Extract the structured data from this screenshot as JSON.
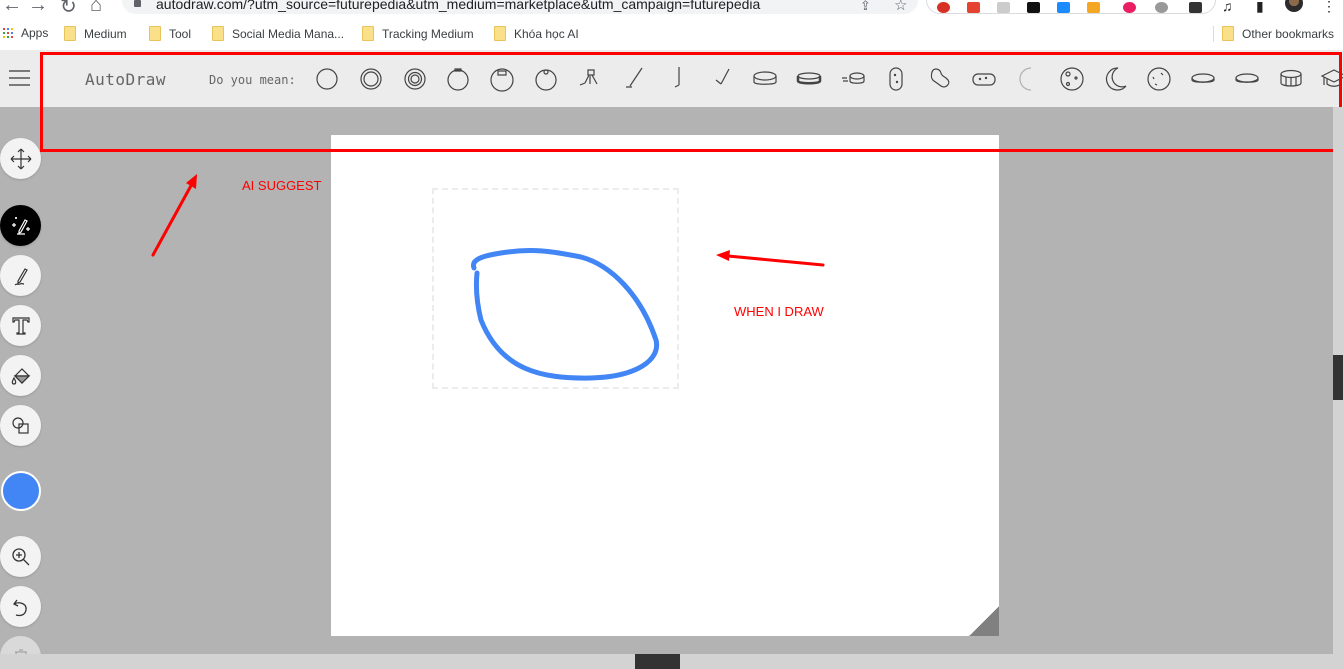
{
  "browser": {
    "url": "autodraw.com/?utm_source=futurepedia&utm_medium=marketplace&utm_campaign=futurepedia",
    "bookmarks": [
      {
        "label": "Apps",
        "icon": "apps-grid-icon"
      },
      {
        "label": "Medium",
        "icon": "folder-icon"
      },
      {
        "label": "Tool",
        "icon": "folder-icon"
      },
      {
        "label": "Social Media Mana...",
        "icon": "folder-icon"
      },
      {
        "label": "Tracking Medium",
        "icon": "folder-icon"
      },
      {
        "label": "Khóa học AI",
        "icon": "folder-icon"
      }
    ],
    "other_bookmarks": "Other bookmarks"
  },
  "header": {
    "brand": "AutoDraw",
    "suggest_label": "Do you mean:",
    "suggestions": [
      "circle",
      "double-circle",
      "triple-circle",
      "ornament",
      "blueberry",
      "blueberry-top",
      "hockey-player",
      "hockey-stick",
      "hockey-stick-vertical",
      "hockey-stick-angled",
      "hockey-puck",
      "hockey-puck-textured",
      "hockey-puck-moving",
      "peanut",
      "peanut-angled",
      "sponge",
      "crescent-faint",
      "moon-craters",
      "crescent-moon",
      "moon-full",
      "coin-flat",
      "coin-flat-2",
      "coin-stack",
      "graduation-cap"
    ]
  },
  "toolbar": {
    "tools": [
      {
        "name": "move",
        "icon": "move-arrows-icon",
        "active": false
      },
      {
        "name": "autodraw",
        "icon": "autodraw-sparkle-pencil-icon",
        "active": true
      },
      {
        "name": "draw",
        "icon": "pencil-icon",
        "active": false
      },
      {
        "name": "type",
        "icon": "text-icon",
        "active": false
      },
      {
        "name": "fill",
        "icon": "paint-bucket-icon",
        "active": false
      },
      {
        "name": "shape",
        "icon": "shapes-icon",
        "active": false
      }
    ],
    "color": "#4285f4",
    "actions": [
      {
        "name": "zoom",
        "icon": "zoom-in-icon"
      },
      {
        "name": "undo",
        "icon": "undo-icon"
      },
      {
        "name": "delete",
        "icon": "trash-icon"
      }
    ]
  },
  "annotations": {
    "ai_suggest": "AI SUGGEST",
    "when_i_draw": "WHEN I DRAW",
    "color": "#ff0000"
  },
  "drawing": {
    "stroke_color": "#4285f4"
  }
}
